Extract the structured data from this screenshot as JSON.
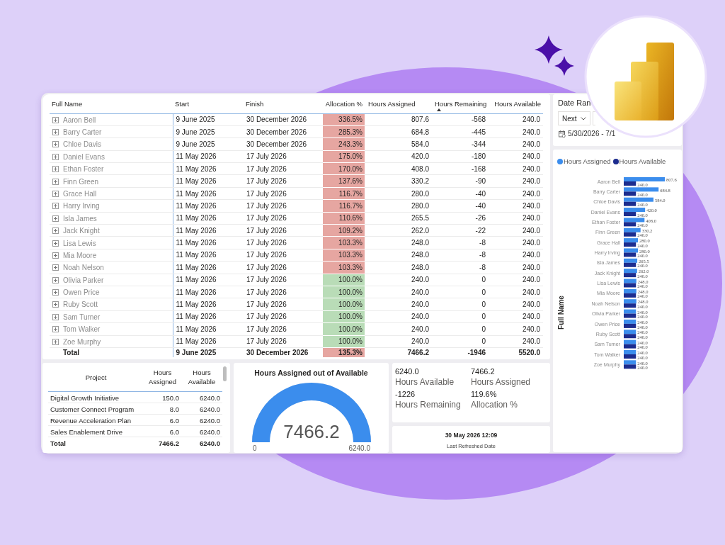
{
  "report": {
    "people_table": {
      "columns": [
        {
          "label": "Full Name",
          "sorted": false
        },
        {
          "label": "Start",
          "sorted": false
        },
        {
          "label": "Finish",
          "sorted": false
        },
        {
          "label": "Allocation %",
          "sorted": false
        },
        {
          "label": "Hours Assigned",
          "sorted": false
        },
        {
          "label": "Hours Remaining",
          "sorted": true
        },
        {
          "label": "Hours Available",
          "sorted": false
        }
      ],
      "rows": [
        {
          "name": "Aaron Bell",
          "expanded": false,
          "start": "9 June 2025",
          "finish": "30 December 2026",
          "allocation": "336.5%",
          "color": "#e6a6a1",
          "hours_assigned": "807.6",
          "hours_remaining": "-568",
          "hours_available": "240.0"
        },
        {
          "name": "Barry Carter",
          "expanded": false,
          "start": "9 June 2025",
          "finish": "30 December 2026",
          "allocation": "285.3%",
          "color": "#e6a6a1",
          "hours_assigned": "684.8",
          "hours_remaining": "-445",
          "hours_available": "240.0"
        },
        {
          "name": "Chloe Davis",
          "expanded": false,
          "start": "9 June 2025",
          "finish": "30 December 2026",
          "allocation": "243.3%",
          "color": "#e6a6a1",
          "hours_assigned": "584.0",
          "hours_remaining": "-344",
          "hours_available": "240.0"
        },
        {
          "name": "Daniel Evans",
          "expanded": false,
          "start": "11 May 2026",
          "finish": "17 July 2026",
          "allocation": "175.0%",
          "color": "#e6a6a1",
          "hours_assigned": "420.0",
          "hours_remaining": "-180",
          "hours_available": "240.0"
        },
        {
          "name": "Ethan Foster",
          "expanded": false,
          "start": "11 May 2026",
          "finish": "17 July 2026",
          "allocation": "170.0%",
          "color": "#e6a6a1",
          "hours_assigned": "408.0",
          "hours_remaining": "-168",
          "hours_available": "240.0"
        },
        {
          "name": "Finn Green",
          "expanded": false,
          "start": "11 May 2026",
          "finish": "17 July 2026",
          "allocation": "137.6%",
          "color": "#e6a6a1",
          "hours_assigned": "330.2",
          "hours_remaining": "-90",
          "hours_available": "240.0"
        },
        {
          "name": "Grace Hall",
          "expanded": false,
          "start": "11 May 2026",
          "finish": "17 July 2026",
          "allocation": "116.7%",
          "color": "#e6a6a1",
          "hours_assigned": "280.0",
          "hours_remaining": "-40",
          "hours_available": "240.0"
        },
        {
          "name": "Harry Irving",
          "expanded": false,
          "start": "11 May 2026",
          "finish": "17 July 2026",
          "allocation": "116.7%",
          "color": "#e6a6a1",
          "hours_assigned": "280.0",
          "hours_remaining": "-40",
          "hours_available": "240.0"
        },
        {
          "name": "Isla James",
          "expanded": false,
          "start": "11 May 2026",
          "finish": "17 July 2026",
          "allocation": "110.6%",
          "color": "#e6a6a1",
          "hours_assigned": "265.5",
          "hours_remaining": "-26",
          "hours_available": "240.0"
        },
        {
          "name": "Jack Knight",
          "expanded": false,
          "start": "11 May 2026",
          "finish": "17 July 2026",
          "allocation": "109.2%",
          "color": "#e6a6a1",
          "hours_assigned": "262.0",
          "hours_remaining": "-22",
          "hours_available": "240.0"
        },
        {
          "name": "Lisa Lewis",
          "expanded": false,
          "start": "11 May 2026",
          "finish": "17 July 2026",
          "allocation": "103.3%",
          "color": "#e6a6a1",
          "hours_assigned": "248.0",
          "hours_remaining": "-8",
          "hours_available": "240.0"
        },
        {
          "name": "Mia Moore",
          "expanded": false,
          "start": "11 May 2026",
          "finish": "17 July 2026",
          "allocation": "103.3%",
          "color": "#e6a6a1",
          "hours_assigned": "248.0",
          "hours_remaining": "-8",
          "hours_available": "240.0"
        },
        {
          "name": "Noah Nelson",
          "expanded": false,
          "start": "11 May 2026",
          "finish": "17 July 2026",
          "allocation": "103.3%",
          "color": "#e6a6a1",
          "hours_assigned": "248.0",
          "hours_remaining": "-8",
          "hours_available": "240.0"
        },
        {
          "name": "Olivia Parker",
          "expanded": false,
          "start": "11 May 2026",
          "finish": "17 July 2026",
          "allocation": "100.0%",
          "color": "#b9dcb7",
          "hours_assigned": "240.0",
          "hours_remaining": "0",
          "hours_available": "240.0"
        },
        {
          "name": "Owen Price",
          "expanded": false,
          "start": "11 May 2026",
          "finish": "17 July 2026",
          "allocation": "100.0%",
          "color": "#b9dcb7",
          "hours_assigned": "240.0",
          "hours_remaining": "0",
          "hours_available": "240.0"
        },
        {
          "name": "Ruby Scott",
          "expanded": false,
          "start": "11 May 2026",
          "finish": "17 July 2026",
          "allocation": "100.0%",
          "color": "#b9dcb7",
          "hours_assigned": "240.0",
          "hours_remaining": "0",
          "hours_available": "240.0"
        },
        {
          "name": "Sam Turner",
          "expanded": false,
          "start": "11 May 2026",
          "finish": "17 July 2026",
          "allocation": "100.0%",
          "color": "#b9dcb7",
          "hours_assigned": "240.0",
          "hours_remaining": "0",
          "hours_available": "240.0"
        },
        {
          "name": "Tom Walker",
          "expanded": false,
          "start": "11 May 2026",
          "finish": "17 July 2026",
          "allocation": "100.0%",
          "color": "#b9dcb7",
          "hours_assigned": "240.0",
          "hours_remaining": "0",
          "hours_available": "240.0"
        },
        {
          "name": "Zoe Murphy",
          "expanded": false,
          "start": "11 May 2026",
          "finish": "17 July 2026",
          "allocation": "100.0%",
          "color": "#b9dcb7",
          "hours_assigned": "240.0",
          "hours_remaining": "0",
          "hours_available": "240.0"
        }
      ],
      "total": {
        "label": "Total",
        "start": "9 June 2025",
        "finish": "30 December 2026",
        "allocation": "135.3%",
        "color": "#e6a6a1",
        "hours_assigned": "7466.2",
        "hours_remaining": "-1946",
        "hours_available": "5520.0"
      }
    },
    "project_table": {
      "columns": [
        "Project",
        "Hours Assigned",
        "Hours Available"
      ],
      "rows": [
        {
          "project": "Digital Growth Initiative",
          "hours_assigned": "150.0",
          "hours_available": "6240.0"
        },
        {
          "project": "Customer Connect Program",
          "hours_assigned": "8.0",
          "hours_available": "6240.0"
        },
        {
          "project": "Revenue Acceleration Plan",
          "hours_assigned": "6.0",
          "hours_available": "6240.0"
        },
        {
          "project": "Sales Enablement Drive",
          "hours_assigned": "6.0",
          "hours_available": "6240.0"
        }
      ],
      "total": {
        "label": "Total",
        "hours_assigned": "7466.2",
        "hours_available": "6240.0"
      }
    },
    "gauge": {
      "title": "Hours Assigned out of Available",
      "value": "7466.2",
      "min_label": "0",
      "max_label": "6240.0",
      "level": 1
    },
    "kpi_card": {
      "items": [
        {
          "value": "6240.0",
          "label": "Hours Available"
        },
        {
          "value": "7466.2",
          "label": "Hours Assigned"
        },
        {
          "value": "-1226",
          "label": "Hours Remaining"
        },
        {
          "value": "119.6%",
          "label": "Allocation %"
        }
      ]
    },
    "refresh_card": {
      "value": "30 May 2026 12:09",
      "label": "Last Refreshed Date"
    },
    "date_range_slicer": {
      "title": "Date Ran",
      "mode": "Next",
      "date_range": "5/30/2026 - 7/1"
    },
    "hours_chart": {
      "chart_data": {
        "type": "bar",
        "orientation": "horizontal",
        "ylabel": "Full Name",
        "categories": [
          "Aaron Bell",
          "Barry Carter",
          "Chloe Davis",
          "Daniel Evans",
          "Ethan Foster",
          "Finn Green",
          "Grace Hall",
          "Harry Irving",
          "Isla James",
          "Jack Knight",
          "Lisa Lewis",
          "Mia Moore",
          "Noah Nelson",
          "Olivia Parker",
          "Owen Price",
          "Ruby Scott",
          "Sam Turner",
          "Tom Walker",
          "Zoe Murphy"
        ],
        "series": [
          {
            "name": "Hours Assigned",
            "color": "#3b8ded",
            "values": [
              807.6,
              684.8,
              584.0,
              420.0,
              408.0,
              330.2,
              280.0,
              280.0,
              265.5,
              262.0,
              248.0,
              248.0,
              248.0,
              240.0,
              240.0,
              240.0,
              240.0,
              240.0,
              240.0
            ],
            "value_labels": [
              "807.6",
              "684.8",
              "584.0",
              "420.0",
              "408.0",
              "330.2",
              "280.0",
              "280.0",
              "265.5",
              "262.0",
              "248.0",
              "248.0",
              "248.0",
              "240.0",
              "240.0",
              "240.0",
              "240.0",
              "240.0",
              "240.0"
            ]
          },
          {
            "name": "Hours Available",
            "color": "#1c2c8e",
            "values": [
              240,
              240,
              240,
              240,
              240,
              240,
              240,
              240,
              240,
              240,
              240,
              240,
              240,
              240,
              240,
              240,
              240,
              240,
              240
            ],
            "value_labels": [
              "240.0",
              "240.0",
              "240.0",
              "240.0",
              "240.0",
              "240.0",
              "240.0",
              "240.0",
              "240.0",
              "240.0",
              "240.0",
              "240.0",
              "240.0",
              "240.0",
              "240.0",
              "240.0",
              "240.0",
              "240.0",
              "240.0"
            ]
          }
        ],
        "data_labels": true
      }
    }
  }
}
